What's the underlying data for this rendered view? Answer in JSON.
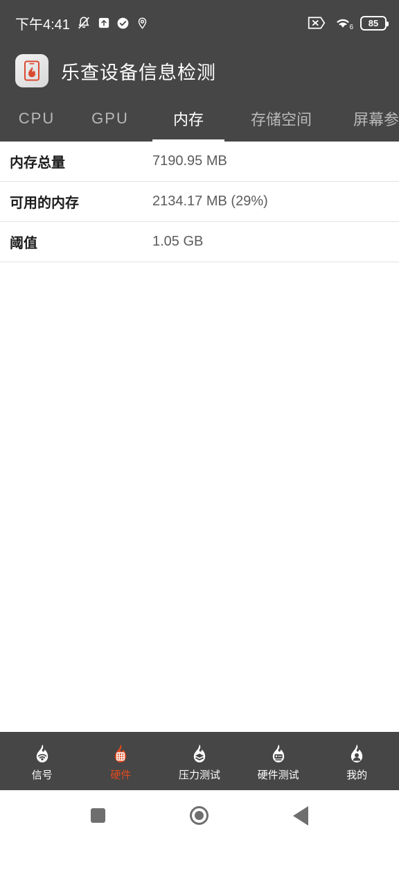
{
  "status_bar": {
    "time": "下午4:41",
    "battery_percent": "85",
    "icons": [
      "bell-muted-icon",
      "upload-box-icon",
      "check-circle-icon",
      "location-pin-icon",
      "no-sim-icon",
      "wifi-6-icon",
      "battery-icon"
    ],
    "wifi_label": "6"
  },
  "app_header": {
    "title": "乐查设备信息检测",
    "icon": "app-flame-phone-icon"
  },
  "tabs": [
    {
      "label": "CPU",
      "active": false
    },
    {
      "label": "GPU",
      "active": false
    },
    {
      "label": "内存",
      "active": true
    },
    {
      "label": "存储空间",
      "active": false
    },
    {
      "label": "屏幕参数",
      "active": false
    }
  ],
  "memory_rows": [
    {
      "label": "内存总量",
      "value": "7190.95 MB"
    },
    {
      "label": "可用的内存",
      "value": "2134.17 MB (29%)"
    },
    {
      "label": "阈值",
      "value": "1.05 GB"
    }
  ],
  "bottom_nav": [
    {
      "label": "信号",
      "icon": "flame-signal-icon",
      "active": false
    },
    {
      "label": "硬件",
      "icon": "flame-chip-icon",
      "active": true
    },
    {
      "label": "压力测试",
      "icon": "flame-layers-icon",
      "active": false
    },
    {
      "label": "硬件测试",
      "icon": "flame-device-icon",
      "active": false
    },
    {
      "label": "我的",
      "icon": "flame-person-icon",
      "active": false
    }
  ],
  "system_nav": [
    {
      "name": "recents-button",
      "icon": "square-icon"
    },
    {
      "name": "home-button",
      "icon": "circle-icon"
    },
    {
      "name": "back-button",
      "icon": "triangle-left-icon"
    }
  ],
  "colors": {
    "header_bg": "#464646",
    "accent": "#e04a1f",
    "content_bg": "#ffffff",
    "divider": "#e2e2e2"
  }
}
